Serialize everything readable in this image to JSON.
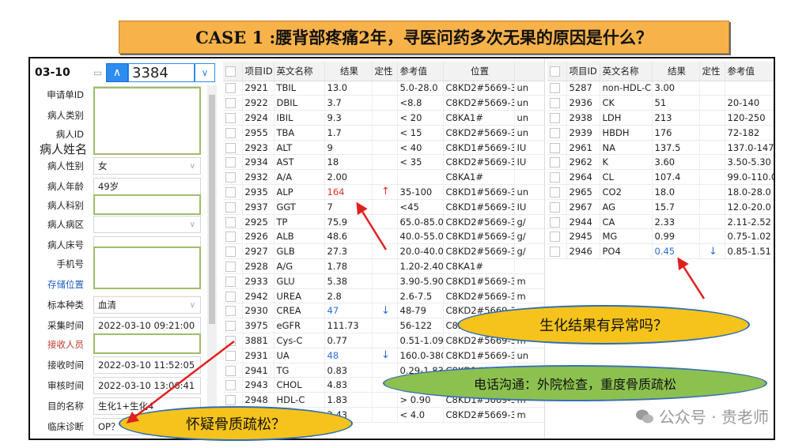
{
  "banner": "CASE 1 :腰背部疼痛2年，寻医问药多次无果的原因是什么？",
  "header": {
    "date": "03-10",
    "specimen_no": "3384"
  },
  "left_fields": [
    {
      "label": "申请单ID",
      "value": ""
    },
    {
      "label": "病人类别",
      "value": ""
    },
    {
      "label": "病人ID",
      "value": ""
    },
    {
      "label": "病人姓名",
      "value": ""
    },
    {
      "label": "病人性别",
      "value": "女"
    },
    {
      "label": "病人年龄",
      "value": "49岁"
    },
    {
      "label": "病人科别",
      "value": ""
    },
    {
      "label": "病人病区",
      "value": ""
    },
    {
      "label": "病人床号",
      "value": ""
    },
    {
      "label": "手机号",
      "value": ""
    },
    {
      "label": "存储位置",
      "value": ""
    },
    {
      "label": "标本种类",
      "value": "血清"
    },
    {
      "label": "采集时间",
      "value": "2022-03-10 09:21:00"
    },
    {
      "label": "接收人员",
      "value": ""
    },
    {
      "label": "接收时间",
      "value": "2022-03-10 11:52:05"
    },
    {
      "label": "审核时间",
      "value": "2022-03-10 13:06:41"
    },
    {
      "label": "目的名称",
      "value": "生化1+生化4"
    },
    {
      "label": "临床诊断",
      "value": "OP？"
    }
  ],
  "table_headers": [
    "项目ID",
    "英文名称",
    "结果",
    "定性",
    "参考值",
    "位置"
  ],
  "table_left": [
    [
      "2921",
      "TBIL",
      "13.0",
      "",
      "5.0-28.0",
      "C8KD2#5669-3",
      "un"
    ],
    [
      "2922",
      "DBIL",
      "3.7",
      "",
      "<8.8",
      "C8KD2#5669-3",
      "un"
    ],
    [
      "2924",
      "IBIL",
      "9.3",
      "",
      "< 20",
      "C8KA1#",
      "un"
    ],
    [
      "2955",
      "TBA",
      "1.7",
      "",
      "< 15",
      "C8KD2#5669-3",
      "un"
    ],
    [
      "2923",
      "ALT",
      "9",
      "",
      "< 40",
      "C8KD1#5669-3",
      "IU"
    ],
    [
      "2934",
      "AST",
      "18",
      "",
      "< 35",
      "C8KD2#5669-3",
      "IU"
    ],
    [
      "2932",
      "A/A",
      "2.00",
      "",
      "",
      "C8KA1#",
      ""
    ],
    [
      "2935",
      "ALP",
      "164",
      "↑",
      "35-100",
      "C8KD1#5669-3",
      "un"
    ],
    [
      "2937",
      "GGT",
      "7",
      "",
      "<45",
      "C8KD1#5669-3",
      "IU"
    ],
    [
      "2925",
      "TP",
      "75.9",
      "",
      "65.0-85.0",
      "C8KD2#5669-3",
      "g/"
    ],
    [
      "2926",
      "ALB",
      "48.6",
      "",
      "40.0-55.0",
      "C8KD1#5669-3",
      "g/"
    ],
    [
      "2927",
      "GLB",
      "27.3",
      "",
      "20.0-40.0",
      "C8KD2#5669-3",
      "g/"
    ],
    [
      "2928",
      "A/G",
      "1.78",
      "",
      "1.20-2.40",
      "C8KA1#",
      ""
    ],
    [
      "2933",
      "GLU",
      "5.38",
      "",
      "3.90-5.90",
      "C8KD1#5669-3",
      "m"
    ],
    [
      "2942",
      "UREA",
      "2.8",
      "",
      "2.6-7.5",
      "C8KD2#5669-3",
      "m"
    ],
    [
      "2930",
      "CREA",
      "47",
      "↓",
      "48-79",
      "C8KD2#5669-3",
      "m"
    ],
    [
      "3975",
      "eGFR",
      "111.73",
      "",
      "56-122",
      "C8KA1#",
      ""
    ],
    [
      "3881",
      "Cys-C",
      "0.77",
      "",
      "0.51-1.09",
      "C8KD2#5669-3",
      "m"
    ],
    [
      "2931",
      "UA",
      "48",
      "↓",
      "160.0-380",
      "C8KD1#5669-3",
      "un"
    ],
    [
      "2941",
      "TG",
      "0.83",
      "",
      "0.29-1.83",
      "C8KD1#5669-3",
      "m"
    ],
    [
      "2943",
      "CHOL",
      "4.83",
      "",
      "< 5.18",
      "C8KD1#5669-3",
      "m"
    ],
    [
      "2948",
      "HDL-C",
      "1.83",
      "",
      "> 0.90",
      "C8KD1#5669-3",
      "m"
    ],
    [
      "2949",
      "LDL-C",
      "2.43",
      "",
      "< 4.0",
      "C8KD2#5669-3",
      "m"
    ]
  ],
  "table_right_headers": [
    "项目ID",
    "英文名称",
    "结果",
    "定性",
    "参考值"
  ],
  "table_right": [
    [
      "5287",
      "non-HDL-C",
      "3.00",
      "",
      ""
    ],
    [
      "2936",
      "CK",
      "51",
      "",
      "20-140"
    ],
    [
      "2938",
      "LDH",
      "213",
      "",
      "120-250"
    ],
    [
      "2939",
      "HBDH",
      "176",
      "",
      "72-182"
    ],
    [
      "2961",
      "NA",
      "137.5",
      "",
      "137.0-147"
    ],
    [
      "2962",
      "K",
      "3.60",
      "",
      "3.50-5.30"
    ],
    [
      "2964",
      "CL",
      "107.4",
      "",
      "99.0-110.0"
    ],
    [
      "2965",
      "CO2",
      "18.0",
      "",
      "18.0-28.0"
    ],
    [
      "2967",
      "AG",
      "15.7",
      "",
      "12.0-20.0"
    ],
    [
      "2944",
      "CA",
      "2.33",
      "",
      "2.11-2.52"
    ],
    [
      "2945",
      "MG",
      "0.99",
      "",
      "0.75-1.02"
    ],
    [
      "2946",
      "PO4",
      "0.45",
      "↓",
      "0.85-1.51"
    ]
  ],
  "callouts": {
    "abnormal": "生化结果有异常吗？",
    "phone": "电话沟通：外院检查，重度骨质疏松",
    "suspect": "怀疑骨质疏松？"
  },
  "watermark": "公众号 · 贵老师",
  "colors": {
    "banner": "#f7b24a",
    "callout_yellow": "#f5c31b",
    "callout_green": "#8cc14f",
    "high": "#e03030",
    "low": "#2a6fdb",
    "arrow": "#e02020"
  }
}
